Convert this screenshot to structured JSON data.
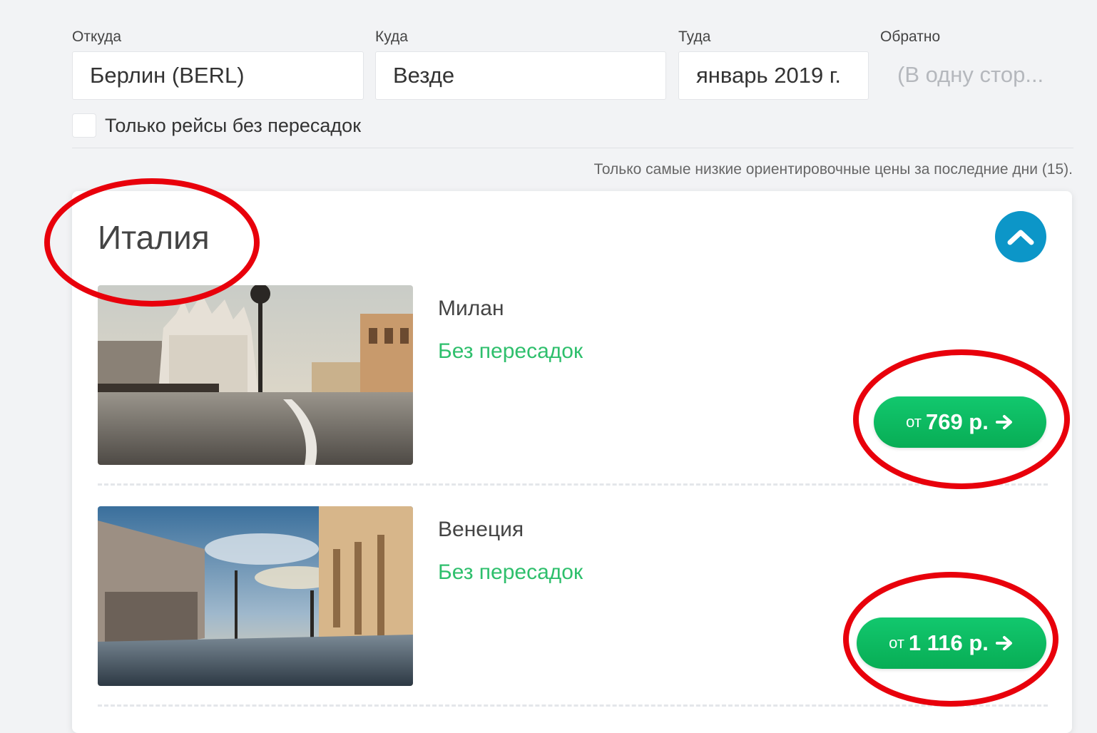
{
  "search": {
    "from": {
      "label": "Откуда",
      "value": "Берлин (BERL)"
    },
    "to": {
      "label": "Куда",
      "value": "Везде"
    },
    "depart": {
      "label": "Туда",
      "value": "январь 2019 г."
    },
    "return": {
      "label": "Обратно",
      "placeholder": "(В одну стор..."
    },
    "direct_only_label": "Только рейсы без пересадок"
  },
  "note": "Только самые низкие ориентировочные цены за последние дни (15).",
  "country": {
    "title": "Италия",
    "collapse_icon": "chevron-up-icon",
    "destinations": [
      {
        "name": "Милан",
        "stops": "Без пересадок",
        "price_prefix": "от",
        "price": "769 р."
      },
      {
        "name": "Венеция",
        "stops": "Без пересадок",
        "price_prefix": "от",
        "price": "1 116 р."
      }
    ]
  },
  "colors": {
    "accent_blue": "#0c96c8",
    "price_green": "#0fbe63",
    "stops_green": "#2ebf6c",
    "annotation_red": "#e8000b"
  }
}
